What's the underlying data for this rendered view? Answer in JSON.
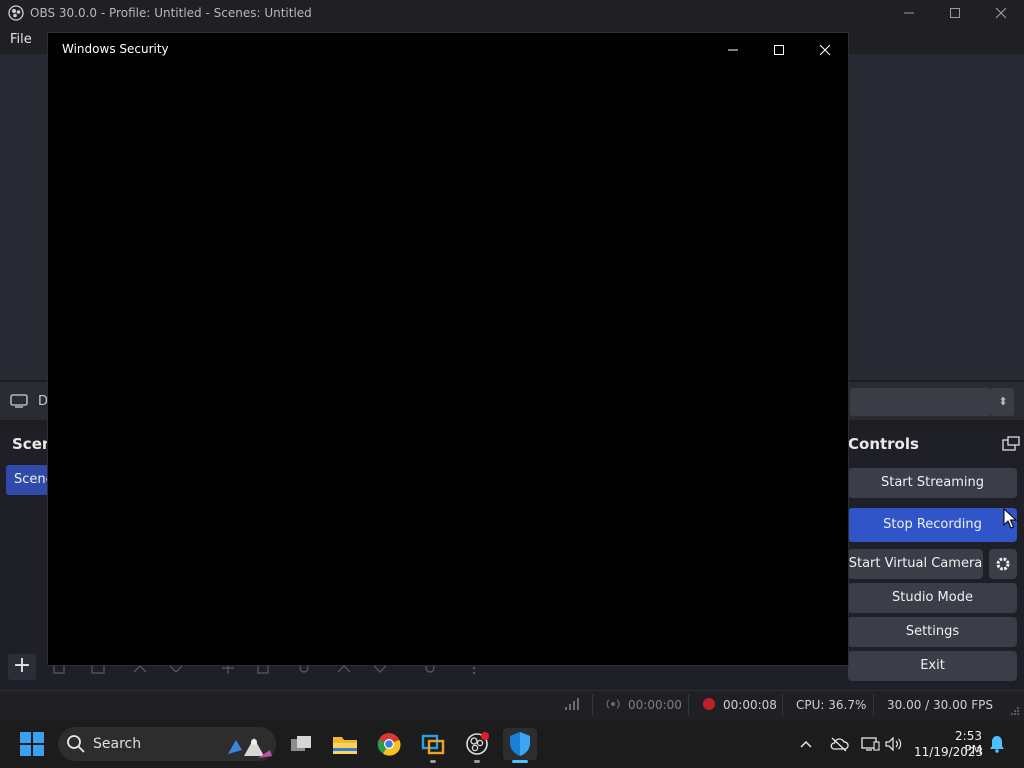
{
  "obs": {
    "title": "OBS 30.0.0 - Profile: Untitled - Scenes: Untitled",
    "menu_file": "File",
    "source_letter": "D",
    "scenes_header": "Scenes",
    "scene_item": "Scene",
    "controls": {
      "header": "Controls",
      "start_streaming": "Start Streaming",
      "stop_recording": "Stop Recording",
      "start_virtual_camera": "Start Virtual Camera",
      "studio_mode": "Studio Mode",
      "settings": "Settings",
      "exit": "Exit"
    },
    "status": {
      "stream_time": "00:00:00",
      "record_time": "00:00:08",
      "cpu": "CPU: 36.7%",
      "fps": "30.00 / 30.00 FPS"
    }
  },
  "dialog": {
    "title": "Windows Security"
  },
  "taskbar": {
    "search_label": "Search",
    "time": "2:53 PM",
    "date": "11/19/2023",
    "apps": [
      "file-explorer-icon",
      "chrome-icon",
      "remote-desktop-icon",
      "obs-icon",
      "windows-security-icon"
    ],
    "accent_color": "#4cc2ff"
  },
  "colors": {
    "accent_blue": "#2f55c8",
    "record_red": "#c0202a"
  }
}
